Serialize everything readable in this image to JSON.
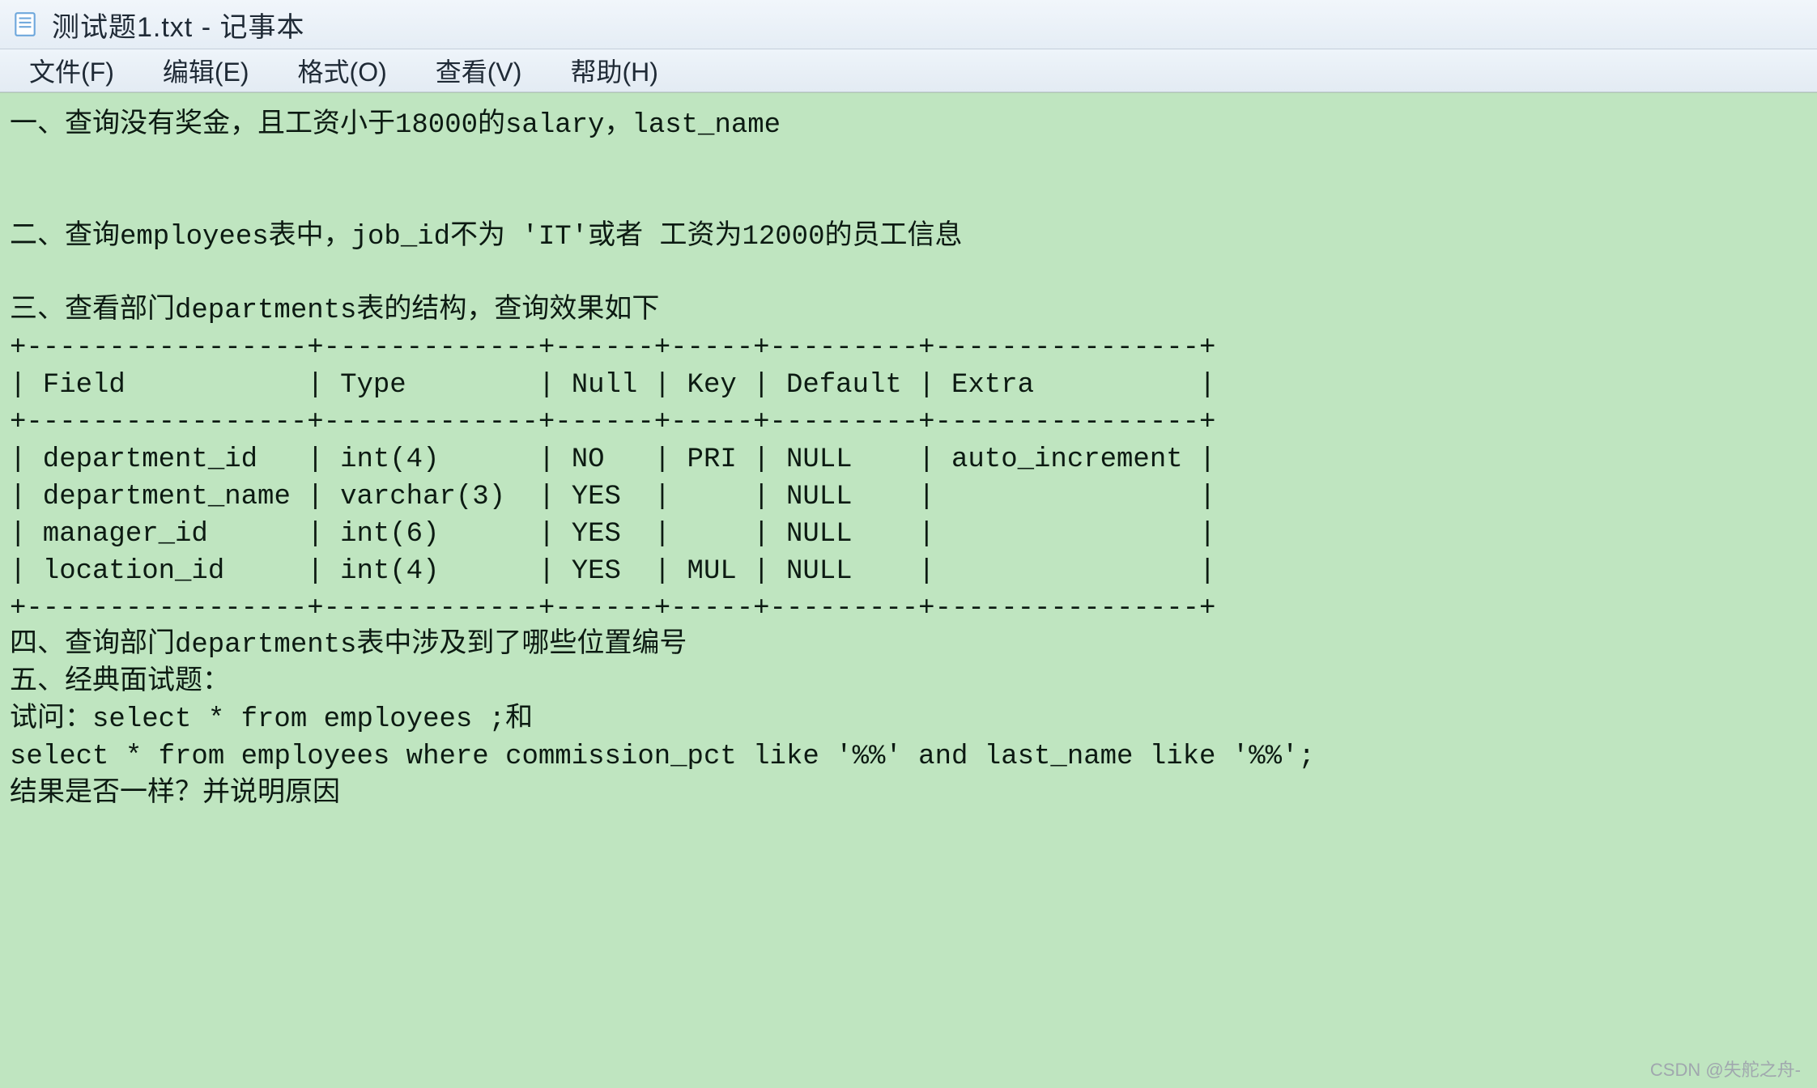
{
  "title": "测试题1.txt - 记事本",
  "menu": {
    "file": "文件(F)",
    "edit": "编辑(E)",
    "format": "格式(O)",
    "view": "查看(V)",
    "help": "帮助(H)"
  },
  "doc": {
    "q1": "一、查询没有奖金，且工资小于18000的salary，last_name",
    "blank": "",
    "q2": "二、查询employees表中，job_id不为 'IT'或者 工资为12000的员工信息",
    "q3": "三、查看部门departments表的结构，查询效果如下",
    "tbl_divider_top": "+-----------------+-------------+------+-----+---------+----------------+",
    "tbl_header": "| Field           | Type        | Null | Key | Default | Extra          |",
    "tbl_divider_mid": "+-----------------+-------------+------+-----+---------+----------------+",
    "tbl_row1": "| department_id   | int(4)      | NO   | PRI | NULL    | auto_increment |",
    "tbl_row2": "| department_name | varchar(3)  | YES  |     | NULL    |                |",
    "tbl_row3": "| manager_id      | int(6)      | YES  |     | NULL    |                |",
    "tbl_row4": "| location_id     | int(4)      | YES  | MUL | NULL    |                |",
    "tbl_divider_bot": "+-----------------+-------------+------+-----+---------+----------------+",
    "q4": "四、查询部门departments表中涉及到了哪些位置编号",
    "q5": "五、经典面试题：",
    "q5a": "试问：select * from employees ;和",
    "q5b": "select * from employees where commission_pct like '%%' and last_name like '%%';",
    "q5c": "结果是否一样？并说明原因"
  },
  "watermark": "CSDN @失舵之舟-"
}
